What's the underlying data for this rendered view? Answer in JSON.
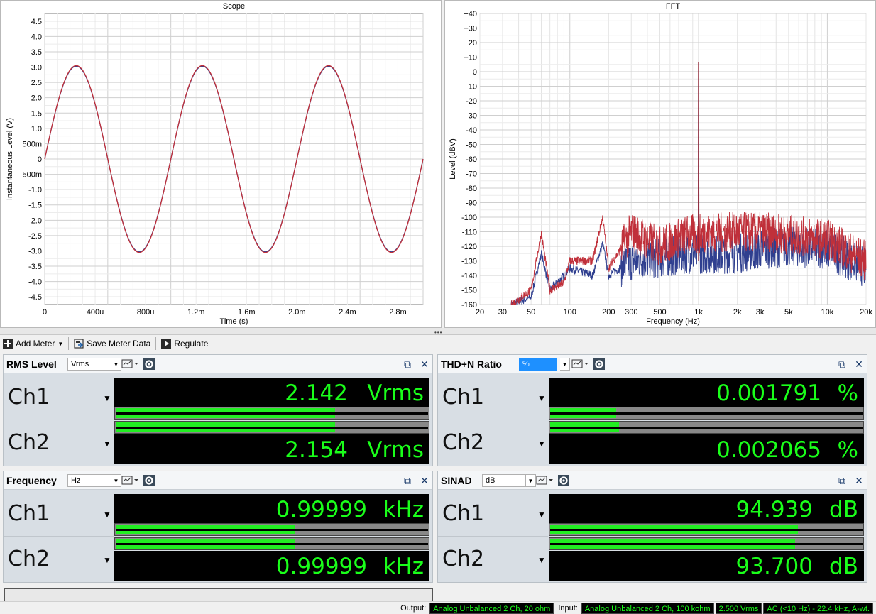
{
  "scope": {
    "title": "Scope",
    "xlabel": "Time (s)",
    "ylabel": "Instantaneous Level (V)",
    "xticks": [
      "0",
      "400u",
      "800u",
      "1.2m",
      "1.6m",
      "2.0m",
      "2.4m",
      "2.8m"
    ],
    "yticks": [
      "4.5",
      "4.0",
      "3.5",
      "3.0",
      "2.5",
      "2.0",
      "1.5",
      "1.0",
      "500m",
      "0",
      "-500m",
      "-1.0",
      "-1.5",
      "-2.0",
      "-2.5",
      "-3.0",
      "-3.5",
      "-4.0",
      "-4.5"
    ]
  },
  "fft": {
    "title": "FFT",
    "xlabel": "Frequency (Hz)",
    "ylabel": "Level (dBV)",
    "xticks": [
      "20",
      "30",
      "50",
      "100",
      "200",
      "300",
      "500",
      "1k",
      "2k",
      "3k",
      "5k",
      "10k",
      "20k"
    ],
    "yticks": [
      "+40",
      "+30",
      "+20",
      "+10",
      "0",
      "-10",
      "-20",
      "-30",
      "-40",
      "-50",
      "-60",
      "-70",
      "-80",
      "-90",
      "-100",
      "-110",
      "-120",
      "-130",
      "-140",
      "-150",
      "-160"
    ]
  },
  "chart_data": [
    {
      "type": "line",
      "title": "Scope",
      "xlabel": "Time (s)",
      "ylabel": "Instantaneous Level (V)",
      "xlim": [
        0,
        0.003
      ],
      "ylim": [
        -4.75,
        4.75
      ],
      "grid": true,
      "series": [
        {
          "color": "#2f3f8f",
          "x": [
            0,
            0.00025,
            0.00075,
            0.00125,
            0.00175,
            0.00225,
            0.00275,
            0.003
          ],
          "y": [
            0,
            3.03,
            -3.03,
            3.03,
            -3.03,
            3.03,
            -3.03,
            0
          ]
        },
        {
          "color": "#c0303a",
          "x": [
            0,
            0.00025,
            0.00075,
            0.00125,
            0.00175,
            0.00225,
            0.00275,
            0.003
          ],
          "y": [
            0,
            3.05,
            -3.05,
            3.05,
            -3.05,
            3.05,
            -3.05,
            0
          ]
        }
      ]
    },
    {
      "type": "line",
      "title": "FFT",
      "xlabel": "Frequency (Hz)",
      "ylabel": "Level (dBV)",
      "xscale": "log",
      "xlim": [
        20,
        20000
      ],
      "ylim": [
        -160,
        40
      ],
      "grid": true,
      "series": [
        {
          "color": "#2f3f8f",
          "x": [
            35,
            50,
            60,
            70,
            90,
            100,
            150,
            180,
            200,
            300,
            500,
            800,
            1000,
            2000,
            3000,
            5000,
            10000,
            20000
          ],
          "y": [
            -160,
            -155,
            -125,
            -150,
            -140,
            -135,
            -140,
            -118,
            -140,
            -130,
            -128,
            -125,
            6.6,
            -125,
            -122,
            -120,
            -122,
            -135
          ]
        },
        {
          "color": "#c0303a",
          "x": [
            35,
            50,
            60,
            70,
            90,
            100,
            150,
            180,
            200,
            300,
            500,
            800,
            1000,
            2000,
            3000,
            5000,
            10000,
            20000
          ],
          "y": [
            -160,
            -150,
            -111,
            -150,
            -145,
            -130,
            -130,
            -100,
            -135,
            -110,
            -120,
            -112,
            6.6,
            -110,
            -110,
            -112,
            -115,
            -130
          ]
        }
      ]
    }
  ],
  "toolbar": {
    "add_meter": "Add Meter",
    "save_meter_data": "Save Meter Data",
    "regulate": "Regulate"
  },
  "meters": {
    "rms": {
      "title": "RMS Level",
      "unit_select": "Vrms",
      "ch1_label": "Ch1",
      "ch2_label": "Ch2",
      "ch1_value": "2.142",
      "ch2_value": "2.154",
      "unit": "Vrms",
      "ch1_bar_fraction": 0.7,
      "ch2_bar_fraction": 0.7
    },
    "thdn": {
      "title": "THD+N Ratio",
      "unit_select": "%",
      "ch1_label": "Ch1",
      "ch2_label": "Ch2",
      "ch1_value": "0.001791",
      "ch2_value": "0.002065",
      "unit": "%",
      "ch1_bar_fraction": 0.21,
      "ch2_bar_fraction": 0.22
    },
    "freq": {
      "title": "Frequency",
      "unit_select": "Hz",
      "ch1_label": "Ch1",
      "ch2_label": "Ch2",
      "ch1_value": "0.99999",
      "ch2_value": "0.99999",
      "unit": "kHz",
      "ch1_bar_fraction": 0.57,
      "ch2_bar_fraction": 0.57
    },
    "sinad": {
      "title": "SINAD",
      "unit_select": "dB",
      "ch1_label": "Ch1",
      "ch2_label": "Ch2",
      "ch1_value": "94.939",
      "ch2_value": "93.700",
      "unit": "dB",
      "ch1_bar_fraction": 0.79,
      "ch2_bar_fraction": 0.78
    }
  },
  "status": {
    "output_label": "Output:",
    "output_value": "Analog Unbalanced 2 Ch, 20 ohm",
    "input_label": "Input:",
    "input_value": "Analog Unbalanced 2 Ch, 100 kohm",
    "level_value": "2.500 Vrms",
    "filter_value": "AC (<10 Hz) - 22.4 kHz, A-wt."
  }
}
